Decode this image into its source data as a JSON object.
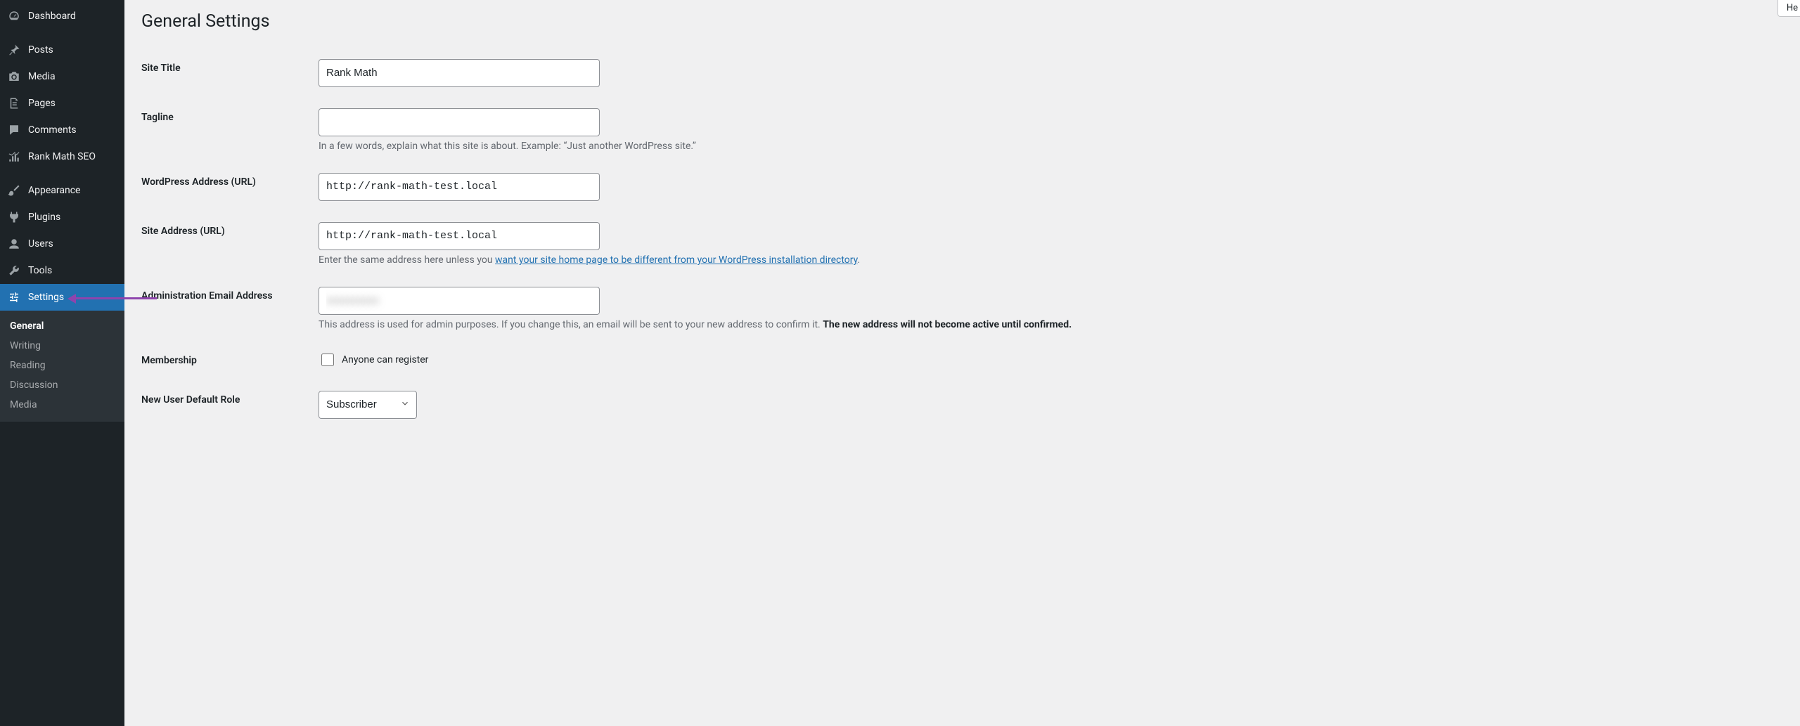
{
  "help_label": "He",
  "page_title": "General Settings",
  "sidebar": {
    "items": [
      {
        "label": "Dashboard"
      },
      {
        "label": "Posts"
      },
      {
        "label": "Media"
      },
      {
        "label": "Pages"
      },
      {
        "label": "Comments"
      },
      {
        "label": "Rank Math SEO"
      },
      {
        "label": "Appearance"
      },
      {
        "label": "Plugins"
      },
      {
        "label": "Users"
      },
      {
        "label": "Tools"
      },
      {
        "label": "Settings"
      }
    ],
    "submenu": [
      {
        "label": "General"
      },
      {
        "label": "Writing"
      },
      {
        "label": "Reading"
      },
      {
        "label": "Discussion"
      },
      {
        "label": "Media"
      }
    ]
  },
  "form": {
    "site_title": {
      "label": "Site Title",
      "value": "Rank Math"
    },
    "tagline": {
      "label": "Tagline",
      "value": "",
      "desc": "In a few words, explain what this site is about. Example: “Just another WordPress site.”"
    },
    "wp_url": {
      "label": "WordPress Address (URL)",
      "value": "http://rank-math-test.local"
    },
    "site_url": {
      "label": "Site Address (URL)",
      "value": "http://rank-math-test.local",
      "desc_pre": "Enter the same address here unless you ",
      "desc_link": "want your site home page to be different from your WordPress installation directory",
      "desc_post": "."
    },
    "admin_email": {
      "label": "Administration Email Address",
      "value": "xxxxxxxxxx",
      "desc_pre": "This address is used for admin purposes. If you change this, an email will be sent to your new address to confirm it. ",
      "desc_strong": "The new address will not become active until confirmed."
    },
    "membership": {
      "label": "Membership",
      "checkbox_label": "Anyone can register"
    },
    "default_role": {
      "label": "New User Default Role",
      "value": "Subscriber"
    }
  }
}
